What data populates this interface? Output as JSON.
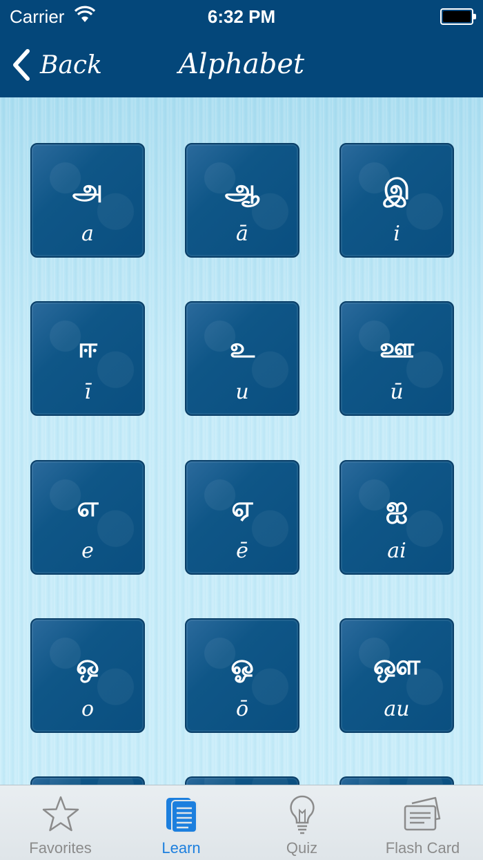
{
  "status_bar": {
    "carrier": "Carrier",
    "time": "6:32 PM"
  },
  "nav": {
    "back_label": "Back",
    "title": "Alphabet"
  },
  "letters": [
    {
      "tamil": "அ",
      "roman": "a"
    },
    {
      "tamil": "ஆ",
      "roman": "ā"
    },
    {
      "tamil": "இ",
      "roman": "i"
    },
    {
      "tamil": "ஈ",
      "roman": "ī"
    },
    {
      "tamil": "உ",
      "roman": "u"
    },
    {
      "tamil": "ஊ",
      "roman": "ū"
    },
    {
      "tamil": "எ",
      "roman": "e"
    },
    {
      "tamil": "ஏ",
      "roman": "ē"
    },
    {
      "tamil": "ஐ",
      "roman": "ai"
    },
    {
      "tamil": "ஒ",
      "roman": "o"
    },
    {
      "tamil": "ஓ",
      "roman": "ō"
    },
    {
      "tamil": "ஔ",
      "roman": "au"
    }
  ],
  "tabs": [
    {
      "label": "Favorites",
      "icon": "star-icon",
      "active": false
    },
    {
      "label": "Learn",
      "icon": "document-list-icon",
      "active": true
    },
    {
      "label": "Quiz",
      "icon": "lightbulb-icon",
      "active": false
    },
    {
      "label": "Flash Card",
      "icon": "flash-card-icon",
      "active": false
    }
  ],
  "colors": {
    "nav_bar": "#04477a",
    "tile": "#0a4f80",
    "active_tab": "#1c7fde",
    "inactive_tab": "#8b8b8b"
  }
}
